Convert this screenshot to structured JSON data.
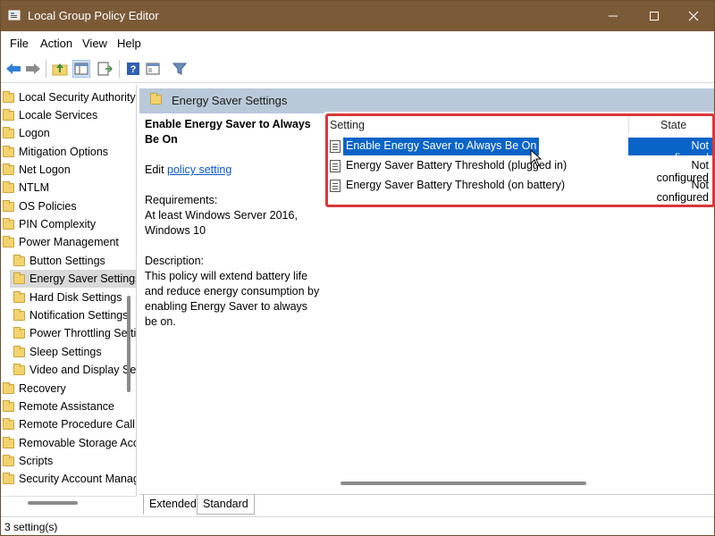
{
  "window": {
    "title": "Local Group Policy Editor"
  },
  "menu": {
    "items": [
      "File",
      "Action",
      "View",
      "Help"
    ]
  },
  "toolbar": {
    "icons": [
      "back-icon",
      "forward-icon",
      "up-folder-icon",
      "show-hide-tree-icon",
      "export-list-icon",
      "help-icon",
      "properties-icon",
      "filter-icon"
    ]
  },
  "tree": {
    "items": [
      {
        "label": "Local Security Authority",
        "level": 0
      },
      {
        "label": "Locale Services",
        "level": 0
      },
      {
        "label": "Logon",
        "level": 0
      },
      {
        "label": "Mitigation Options",
        "level": 0
      },
      {
        "label": "Net Logon",
        "level": 0
      },
      {
        "label": "NTLM",
        "level": 0
      },
      {
        "label": "OS Policies",
        "level": 0
      },
      {
        "label": "PIN Complexity",
        "level": 0
      },
      {
        "label": "Power Management",
        "level": 0
      },
      {
        "label": "Button Settings",
        "level": 1
      },
      {
        "label": "Energy Saver Settings",
        "level": 1,
        "selected": true
      },
      {
        "label": "Hard Disk Settings",
        "level": 1
      },
      {
        "label": "Notification Settings",
        "level": 1
      },
      {
        "label": "Power Throttling Settings",
        "level": 1
      },
      {
        "label": "Sleep Settings",
        "level": 1
      },
      {
        "label": "Video and Display Settings",
        "level": 1
      },
      {
        "label": "Recovery",
        "level": 0
      },
      {
        "label": "Remote Assistance",
        "level": 0
      },
      {
        "label": "Remote Procedure Call",
        "level": 0
      },
      {
        "label": "Removable Storage Access",
        "level": 0
      },
      {
        "label": "Scripts",
        "level": 0
      },
      {
        "label": "Security Account Manager",
        "level": 0
      }
    ]
  },
  "header": {
    "title": "Energy Saver Settings"
  },
  "description": {
    "title": "Enable Energy Saver to Always Be On",
    "edit_prefix": "Edit ",
    "edit_link": "policy setting",
    "requirements_label": "Requirements:",
    "requirements_text": "At least Windows Server 2016, Windows 10",
    "description_label": "Description:",
    "description_text": "This policy will extend battery life and reduce energy consumption by enabling Energy Saver to always be on."
  },
  "list": {
    "columns": {
      "setting": "Setting",
      "state": "State"
    },
    "rows": [
      {
        "name": "Enable Energy Saver to Always Be On",
        "state": "Not configured",
        "selected": true
      },
      {
        "name": "Energy Saver Battery Threshold (plugged in)",
        "state": "Not configured"
      },
      {
        "name": "Energy Saver Battery Threshold (on battery)",
        "state": "Not configured"
      }
    ]
  },
  "tabs": {
    "extended": "Extended",
    "standard": "Standard"
  },
  "status": {
    "text": "3 setting(s)"
  },
  "colors": {
    "titlebar": "#7b5a38",
    "selection": "#0a64c8",
    "highlight": "#d9383a",
    "header_band": "#b9c9d9"
  }
}
